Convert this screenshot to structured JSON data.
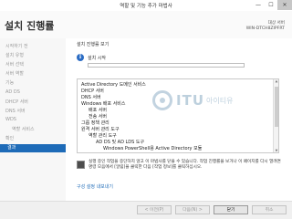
{
  "window": {
    "title": "역할 및 기능 추가 마법사",
    "minimize_glyph": "—",
    "maximize_glyph": "☐",
    "close_glyph": "✕"
  },
  "header": {
    "page_title": "설치 진행률",
    "server_label": "대상 서버",
    "server_name": "WIN-DTCH8ZIPFRT"
  },
  "sidebar": {
    "items": [
      {
        "label": "시작하기 전"
      },
      {
        "label": "설치 유형"
      },
      {
        "label": "서버 선택"
      },
      {
        "label": "서버 역할"
      },
      {
        "label": "기능"
      },
      {
        "label": "AD DS"
      },
      {
        "label": "DHCP 서버"
      },
      {
        "label": "DNS 서버"
      },
      {
        "label": "WDS"
      },
      {
        "label": "역할 서비스"
      },
      {
        "label": "확인"
      },
      {
        "label": "결과"
      }
    ]
  },
  "main": {
    "section_label": "설치 진행률 보기",
    "info_glyph": "i",
    "install_status": "설치 시작",
    "progress": 0.0,
    "features": [
      {
        "label": "Active Directory 도메인 서비스"
      },
      {
        "label": "DHCP 서버"
      },
      {
        "label": "DNS 서버"
      },
      {
        "label": "Windows 배포 서비스"
      },
      {
        "label": "배포 서버"
      },
      {
        "label": "전송 서버"
      },
      {
        "label": "그룹 정책 관리"
      },
      {
        "label": "원격 서버 관리 도구"
      },
      {
        "label": "역할 관리 도구"
      },
      {
        "label": "AD DS 및 AD LDS 도구"
      },
      {
        "label": "Windows PowerShell용 Active Directory 모듈"
      }
    ],
    "notice": "실행 중인 작업을 중단하지 않고 이 마법사를 닫을 수 있습니다. 작업 진행률을 보거나 이 페이지를 다시 열려면 명령 모음에서 [알림]을 클릭한 다음 [작업 정보]를 클릭하십시오.",
    "export_link": "구성 설정 내보내기"
  },
  "watermark": {
    "brand": "ITU",
    "sub": "아이티유"
  },
  "footer": {
    "prev": "< 이전(P)",
    "next": "다음(N) >",
    "close": "닫기",
    "cancel": "취소"
  },
  "colors": {
    "accent": "#1e6bb8",
    "info": "#2b6cc4"
  }
}
